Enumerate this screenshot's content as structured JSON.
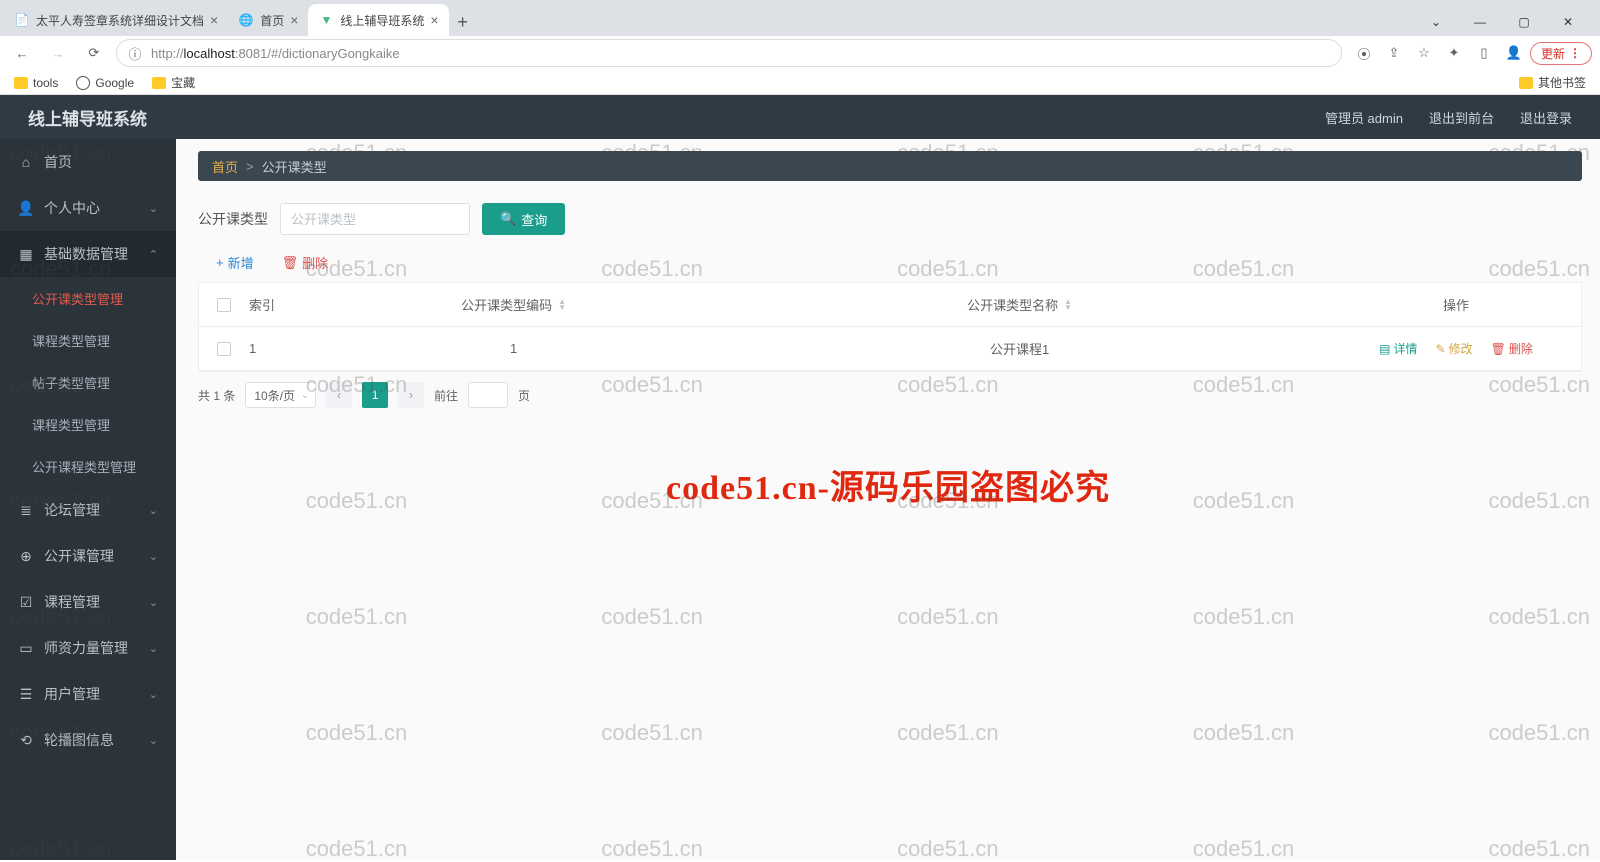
{
  "browser": {
    "tabs": [
      {
        "title": "太平人寿签章系统详细设计文档",
        "active": false,
        "icon": "doc"
      },
      {
        "title": "首页",
        "active": false,
        "icon": "globe"
      },
      {
        "title": "线上辅导班系统",
        "active": true,
        "icon": "vue"
      }
    ],
    "url": "http://localhost:8081/#/dictionaryGongkaike",
    "url_host": "localhost",
    "url_rest": ":8081/#/dictionaryGongkaike",
    "bookmarks": [
      "tools",
      "Google",
      "宝藏"
    ],
    "other_bookmarks": "其他书签",
    "update_label": "更新"
  },
  "header": {
    "title": "线上辅导班系统",
    "links": [
      "管理员 admin",
      "退出到前台",
      "退出登录"
    ]
  },
  "sidebar": {
    "items": [
      {
        "label": "首页",
        "icon": "home"
      },
      {
        "label": "个人中心",
        "icon": "user",
        "chev": "down"
      },
      {
        "label": "基础数据管理",
        "icon": "grid",
        "chev": "up",
        "expanded": true,
        "subs": [
          {
            "label": "公开课类型管理",
            "active": true
          },
          {
            "label": "课程类型管理"
          },
          {
            "label": "帖子类型管理"
          },
          {
            "label": "课程类型管理"
          },
          {
            "label": "公开课程类型管理"
          }
        ]
      },
      {
        "label": "论坛管理",
        "icon": "list",
        "chev": "down"
      },
      {
        "label": "公开课管理",
        "icon": "target",
        "chev": "down"
      },
      {
        "label": "课程管理",
        "icon": "check",
        "chev": "down"
      },
      {
        "label": "师资力量管理",
        "icon": "device",
        "chev": "down"
      },
      {
        "label": "用户管理",
        "icon": "bars",
        "chev": "down"
      },
      {
        "label": "轮播图信息",
        "icon": "refresh",
        "chev": "down"
      }
    ]
  },
  "breadcrumb": {
    "home": "首页",
    "sep": ">",
    "current": "公开课类型"
  },
  "search": {
    "label": "公开课类型",
    "placeholder": "公开课类型",
    "button": "查询"
  },
  "actions": {
    "add": "新增",
    "delete": "删除"
  },
  "table": {
    "headers": {
      "index": "索引",
      "code": "公开课类型编码",
      "name": "公开课类型名称",
      "ops": "操作"
    },
    "rows": [
      {
        "index": "1",
        "code": "1",
        "name": "公开课程1"
      }
    ],
    "ops": {
      "detail": "详情",
      "edit": "修改",
      "delete": "删除"
    }
  },
  "pagination": {
    "total": "共 1 条",
    "per_page": "10条/页",
    "page": "1",
    "goto": "前往",
    "goto_suffix": "页"
  },
  "watermark": {
    "repeat": "code51.cn",
    "banner": "code51.cn-源码乐园盗图必究"
  }
}
